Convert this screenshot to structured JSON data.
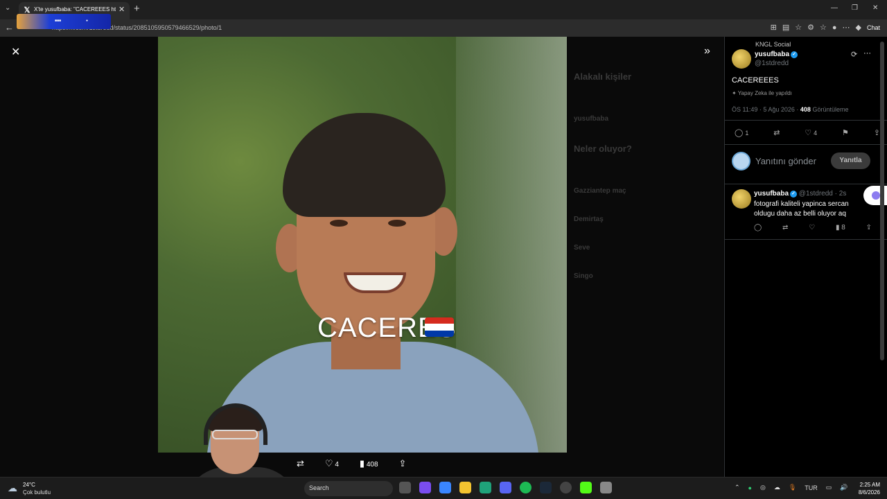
{
  "browser": {
    "tab_title": "X'te yusufbaba: \"CACEREEES htt",
    "url": "https://x.com/1stdredd/status/2085105950579466529/photo/1",
    "chat_label": "Chat"
  },
  "viewer": {
    "caption": "CACERES",
    "actions": {
      "likes": "4",
      "views": "408"
    },
    "flag_colors": [
      "#d52b1e",
      "#ffffff",
      "#0038a8"
    ]
  },
  "background_sidebar": {
    "heading1": "Alakalı kişiler",
    "user": "yusufbaba",
    "heading2": "Neler oluyor?",
    "items": [
      "Gazziantep maç",
      "Demirtaş",
      "Seve",
      "Singo"
    ]
  },
  "panel": {
    "community": "KNGL Social",
    "author": {
      "name": "yusufbaba",
      "handle": "@1stdredd"
    },
    "tweet_text": "CACEREEES",
    "ai_note": "Yapay Zeka ile yapıldı",
    "timestamp": "ÖS 11:49 · 5 Ağu 2026 ·",
    "view_count": "408",
    "views_label": "Görüntüleme",
    "counts": {
      "replies": "1",
      "likes": "4"
    },
    "reply_placeholder": "Yanıtını gönder",
    "reply_button": "Yanıtla",
    "reply": {
      "name": "yusufbaba",
      "handle_time": "@1stdredd · 2s",
      "text": "fotografi kaliteli yapinca sercan oldugu daha az belli oluyor aq",
      "views": "8"
    }
  },
  "taskbar": {
    "temperature": "24°C",
    "weather": "Çok bulutlu",
    "search": "Search",
    "language": "TUR",
    "time": "2:25 AM",
    "date": "8/6/2026"
  },
  "colors": {
    "accent": "#1d9bf0",
    "background": "#000000",
    "muted": "#71767b"
  }
}
